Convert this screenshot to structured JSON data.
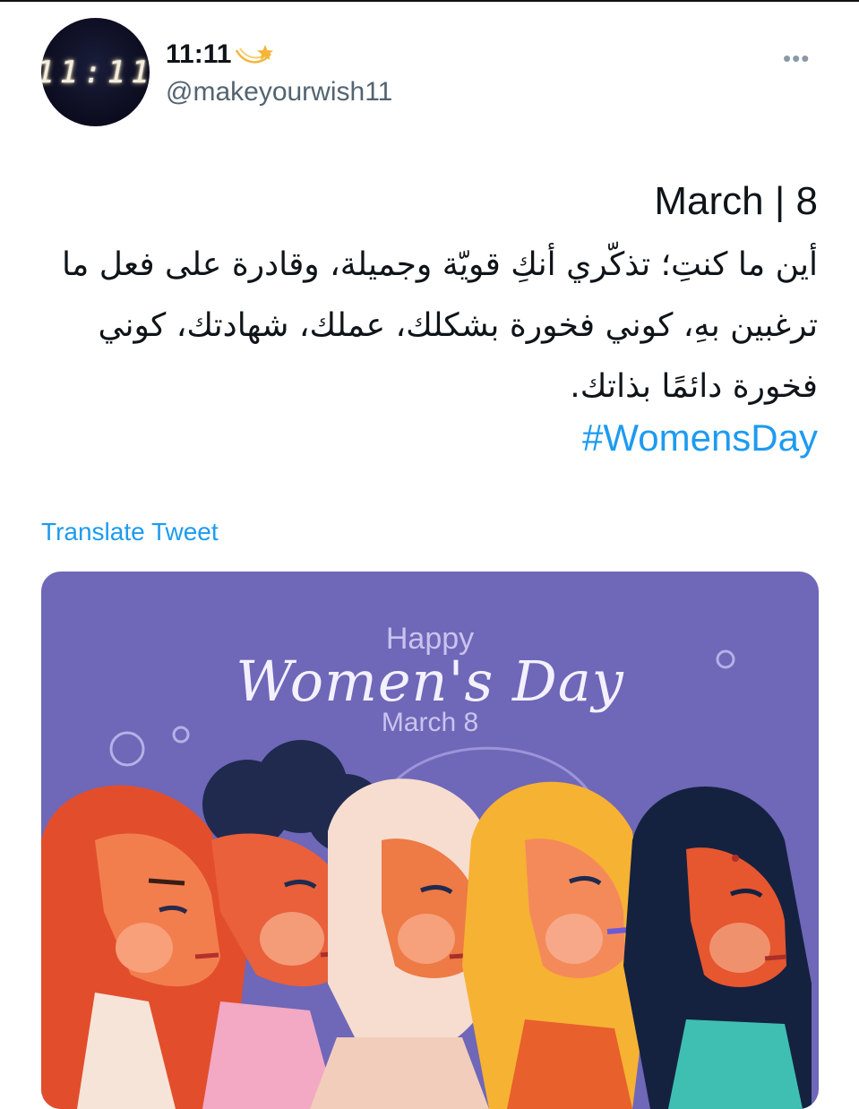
{
  "author": {
    "avatar_text": "11:11",
    "display_name": "11:11",
    "name_emoji_icon": "shooting-star-icon",
    "handle": "@makeyourwish11",
    "more_icon": "more-options-icon"
  },
  "tweet": {
    "title": "March | 8",
    "body": "أين ما كنتِ؛ تذكّري أنكِ قويّة وجميلة، وقادرة على فعل ما ترغبين بهِ، كوني فخورة بشكلك، عملك، شهادتك، كوني فخورة دائمًا بذاتك.",
    "hashtag": "#WomensDay",
    "translate_label": "Translate Tweet"
  },
  "media": {
    "happy": "Happy",
    "womens_day": "Women's Day",
    "march": "March 8"
  },
  "colors": {
    "link": "#1d9bf0",
    "secondary": "#536471",
    "media_bg": "#6f67b8"
  }
}
